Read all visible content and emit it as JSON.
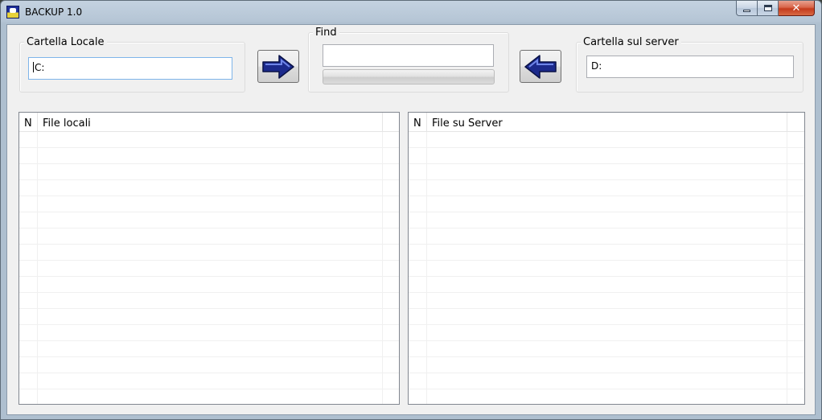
{
  "window": {
    "title": "BACKUP 1.0",
    "controls": {
      "minimize_icon": "minimize-icon",
      "maximize_icon": "maximize-icon",
      "close_label": "✕"
    }
  },
  "local_folder": {
    "label": "Cartella Locale",
    "value": "C:"
  },
  "find": {
    "label": "Find",
    "value": "",
    "progress": 0
  },
  "server_folder": {
    "label": "Cartella sul server",
    "value": "D:"
  },
  "buttons": {
    "copy_to_server_icon": "arrow-right-icon",
    "copy_to_local_icon": "arrow-left-icon",
    "arrow_color": "#1c2a8c"
  },
  "local_list": {
    "columns": [
      "N",
      "File locali",
      ""
    ],
    "rows": []
  },
  "server_list": {
    "columns": [
      "N",
      "File su Server",
      ""
    ],
    "rows": []
  }
}
